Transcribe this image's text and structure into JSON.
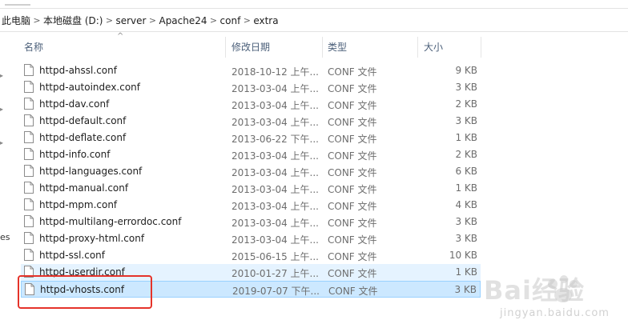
{
  "breadcrumb": [
    "此电脑",
    "本地磁盘 (D:)",
    "server",
    "Apache24",
    "conf",
    "extra"
  ],
  "breadcrumb_separator": ">",
  "columns": {
    "name": "名称",
    "date": "修改日期",
    "type": "类型",
    "size": "大小"
  },
  "sort_indicator": "^",
  "left_pane_text": "es",
  "files": [
    {
      "name": "httpd-ahssl.conf",
      "date": "2018-10-12 上午...",
      "type": "CONF 文件",
      "size": "9 KB"
    },
    {
      "name": "httpd-autoindex.conf",
      "date": "2013-03-04 上午...",
      "type": "CONF 文件",
      "size": "3 KB"
    },
    {
      "name": "httpd-dav.conf",
      "date": "2013-03-04 上午...",
      "type": "CONF 文件",
      "size": "2 KB"
    },
    {
      "name": "httpd-default.conf",
      "date": "2013-03-04 上午...",
      "type": "CONF 文件",
      "size": "3 KB"
    },
    {
      "name": "httpd-deflate.conf",
      "date": "2013-06-22 下午...",
      "type": "CONF 文件",
      "size": "1 KB"
    },
    {
      "name": "httpd-info.conf",
      "date": "2013-03-04 上午...",
      "type": "CONF 文件",
      "size": "2 KB"
    },
    {
      "name": "httpd-languages.conf",
      "date": "2013-03-04 上午...",
      "type": "CONF 文件",
      "size": "6 KB"
    },
    {
      "name": "httpd-manual.conf",
      "date": "2013-03-04 上午...",
      "type": "CONF 文件",
      "size": "1 KB"
    },
    {
      "name": "httpd-mpm.conf",
      "date": "2013-03-04 上午...",
      "type": "CONF 文件",
      "size": "4 KB"
    },
    {
      "name": "httpd-multilang-errordoc.conf",
      "date": "2013-03-04 上午...",
      "type": "CONF 文件",
      "size": "3 KB"
    },
    {
      "name": "httpd-proxy-html.conf",
      "date": "2013-03-04 上午...",
      "type": "CONF 文件",
      "size": "3 KB"
    },
    {
      "name": "httpd-ssl.conf",
      "date": "2015-06-15 上午...",
      "type": "CONF 文件",
      "size": "10 KB"
    },
    {
      "name": "httpd-userdir.conf",
      "date": "2010-01-27 上午...",
      "type": "CONF 文件",
      "size": "1 KB",
      "state": "hover"
    },
    {
      "name": "httpd-vhosts.conf",
      "date": "2019-07-07 下午...",
      "type": "CONF 文件",
      "size": "3 KB",
      "state": "selected"
    }
  ],
  "highlight_color": "#e5332a",
  "selection_color": "#cce8ff",
  "watermark": {
    "brand": "Bai经验",
    "url": "jingyan.baidu.com"
  }
}
